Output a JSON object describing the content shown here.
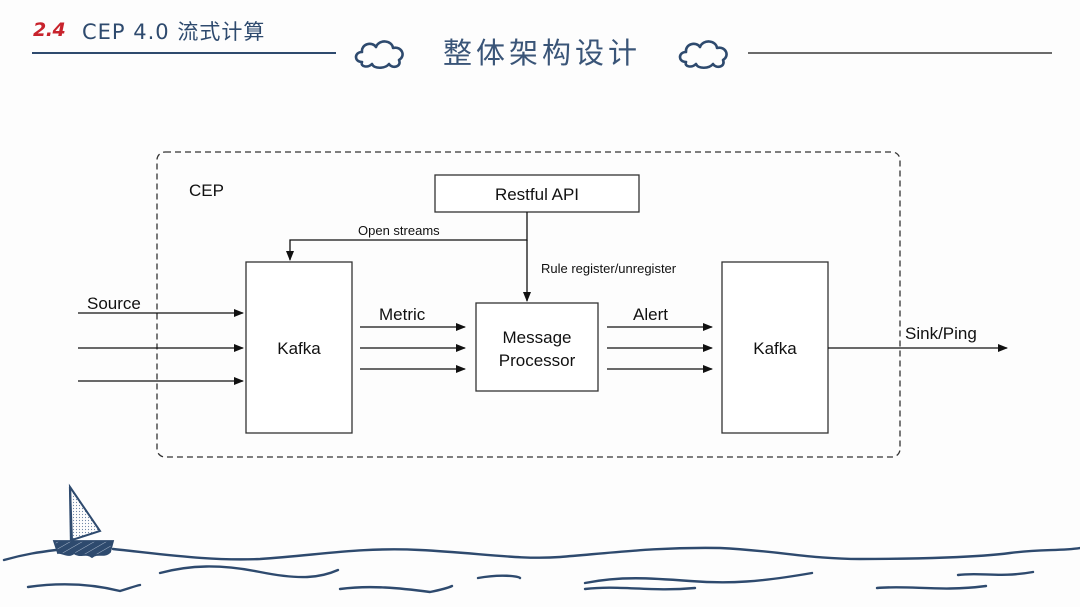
{
  "header": {
    "section_number": "2.4",
    "section_title": "CEP 4.0 流式计算",
    "slide_title": "整体架构设计",
    "accent_color": "#c8232c",
    "ink_color": "#2e4a6e"
  },
  "diagram": {
    "boundary_label": "CEP",
    "nodes": {
      "restful_api": "Restful API",
      "kafka_in": "Kafka",
      "message_processor_line1": "Message",
      "message_processor_line2": "Processor",
      "kafka_out": "Kafka"
    },
    "edges": {
      "source": "Source",
      "open_streams": "Open streams",
      "rule_register": "Rule register/unregister",
      "metric": "Metric",
      "alert": "Alert",
      "sink": "Sink/Ping"
    }
  },
  "decorations": {
    "left_cloud": "cloud-icon",
    "right_cloud": "cloud-icon",
    "footer": "sailboat-on-waves"
  }
}
